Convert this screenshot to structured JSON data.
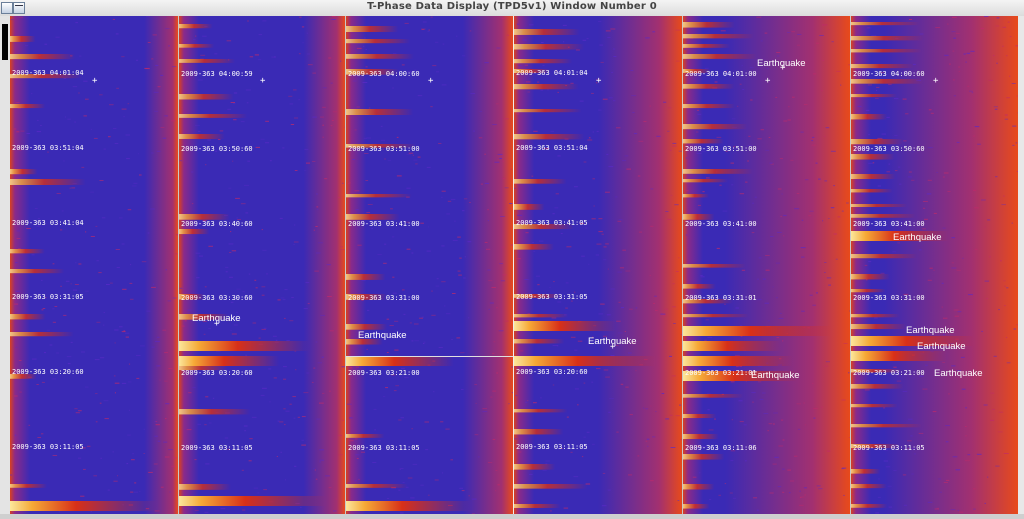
{
  "window": {
    "title": "T-Phase Data Display (TPD5v1) Window Number 0"
  },
  "event_label": "Earthquake",
  "colors": {
    "background_blue": "#3a2ab5",
    "signal_red": "#e02810",
    "signal_yellow": "#ffe060"
  },
  "panels": [
    {
      "name": "panel-1",
      "timestamps": [
        "2009-363 04:01:04",
        "2009-363 03:51:04",
        "2009-363 03:41:04",
        "2009-363 03:31:05",
        "2009-363 03:20:60",
        "2009-363 03:11:05"
      ],
      "events": []
    },
    {
      "name": "panel-2",
      "timestamps": [
        "2009-363 04:00:59",
        "2009-363 03:50:60",
        "2009-363 03:40:60",
        "2009-363 03:30:60",
        "2009-363 03:20:60",
        "2009-363 03:11:05"
      ],
      "events": [
        "Earthquake"
      ]
    },
    {
      "name": "panel-3",
      "timestamps": [
        "2009-363 04:00:60",
        "2009-363 03:51:00",
        "2009-363 03:41:00",
        "2009-363 03:31:00",
        "2009-363 03:21:00",
        "2009-363 03:11:05"
      ],
      "events": [
        "Earthquake"
      ]
    },
    {
      "name": "panel-4",
      "timestamps": [
        "2009-363 04:01:04",
        "2009-363 03:51:04",
        "2009-363 03:41:05",
        "2009-363 03:31:05",
        "2009-363 03:20:60",
        "2009-363 03:11:05"
      ],
      "events": [
        "Earthquake"
      ]
    },
    {
      "name": "panel-5",
      "timestamps": [
        "2009-363 04:01:00",
        "2009-363 03:51:00",
        "2009-363 03:41:00",
        "2009-363 03:31:01",
        "2009-363 03:21:01",
        "2009-363 03:11:06"
      ],
      "events": [
        "Earthquake",
        "Earthquake"
      ]
    },
    {
      "name": "panel-6",
      "timestamps": [
        "2009-363 04:00:60",
        "2009-363 03:50:60",
        "2009-363 03:41:00",
        "2009-363 03:31:00",
        "2009-363 03:21:00",
        "2009-363 03:11:05"
      ],
      "events": [
        "Earthquake",
        "Earthquake",
        "Earthquake",
        "Earthquake"
      ]
    }
  ]
}
